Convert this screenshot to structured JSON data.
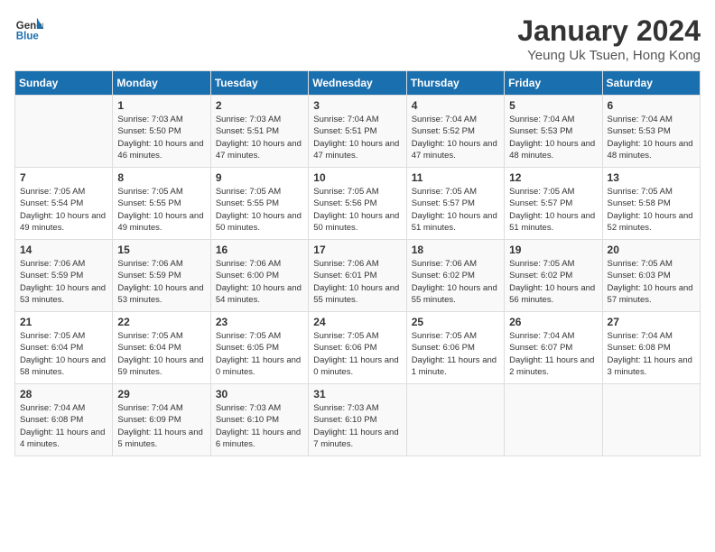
{
  "header": {
    "logo_line1": "General",
    "logo_line2": "Blue",
    "month": "January 2024",
    "location": "Yeung Uk Tsuen, Hong Kong"
  },
  "days_of_week": [
    "Sunday",
    "Monday",
    "Tuesday",
    "Wednesday",
    "Thursday",
    "Friday",
    "Saturday"
  ],
  "weeks": [
    [
      {
        "day": "",
        "sunrise": "",
        "sunset": "",
        "daylight": ""
      },
      {
        "day": "1",
        "sunrise": "Sunrise: 7:03 AM",
        "sunset": "Sunset: 5:50 PM",
        "daylight": "Daylight: 10 hours and 46 minutes."
      },
      {
        "day": "2",
        "sunrise": "Sunrise: 7:03 AM",
        "sunset": "Sunset: 5:51 PM",
        "daylight": "Daylight: 10 hours and 47 minutes."
      },
      {
        "day": "3",
        "sunrise": "Sunrise: 7:04 AM",
        "sunset": "Sunset: 5:51 PM",
        "daylight": "Daylight: 10 hours and 47 minutes."
      },
      {
        "day": "4",
        "sunrise": "Sunrise: 7:04 AM",
        "sunset": "Sunset: 5:52 PM",
        "daylight": "Daylight: 10 hours and 47 minutes."
      },
      {
        "day": "5",
        "sunrise": "Sunrise: 7:04 AM",
        "sunset": "Sunset: 5:53 PM",
        "daylight": "Daylight: 10 hours and 48 minutes."
      },
      {
        "day": "6",
        "sunrise": "Sunrise: 7:04 AM",
        "sunset": "Sunset: 5:53 PM",
        "daylight": "Daylight: 10 hours and 48 minutes."
      }
    ],
    [
      {
        "day": "7",
        "sunrise": "Sunrise: 7:05 AM",
        "sunset": "Sunset: 5:54 PM",
        "daylight": "Daylight: 10 hours and 49 minutes."
      },
      {
        "day": "8",
        "sunrise": "Sunrise: 7:05 AM",
        "sunset": "Sunset: 5:55 PM",
        "daylight": "Daylight: 10 hours and 49 minutes."
      },
      {
        "day": "9",
        "sunrise": "Sunrise: 7:05 AM",
        "sunset": "Sunset: 5:55 PM",
        "daylight": "Daylight: 10 hours and 50 minutes."
      },
      {
        "day": "10",
        "sunrise": "Sunrise: 7:05 AM",
        "sunset": "Sunset: 5:56 PM",
        "daylight": "Daylight: 10 hours and 50 minutes."
      },
      {
        "day": "11",
        "sunrise": "Sunrise: 7:05 AM",
        "sunset": "Sunset: 5:57 PM",
        "daylight": "Daylight: 10 hours and 51 minutes."
      },
      {
        "day": "12",
        "sunrise": "Sunrise: 7:05 AM",
        "sunset": "Sunset: 5:57 PM",
        "daylight": "Daylight: 10 hours and 51 minutes."
      },
      {
        "day": "13",
        "sunrise": "Sunrise: 7:05 AM",
        "sunset": "Sunset: 5:58 PM",
        "daylight": "Daylight: 10 hours and 52 minutes."
      }
    ],
    [
      {
        "day": "14",
        "sunrise": "Sunrise: 7:06 AM",
        "sunset": "Sunset: 5:59 PM",
        "daylight": "Daylight: 10 hours and 53 minutes."
      },
      {
        "day": "15",
        "sunrise": "Sunrise: 7:06 AM",
        "sunset": "Sunset: 5:59 PM",
        "daylight": "Daylight: 10 hours and 53 minutes."
      },
      {
        "day": "16",
        "sunrise": "Sunrise: 7:06 AM",
        "sunset": "Sunset: 6:00 PM",
        "daylight": "Daylight: 10 hours and 54 minutes."
      },
      {
        "day": "17",
        "sunrise": "Sunrise: 7:06 AM",
        "sunset": "Sunset: 6:01 PM",
        "daylight": "Daylight: 10 hours and 55 minutes."
      },
      {
        "day": "18",
        "sunrise": "Sunrise: 7:06 AM",
        "sunset": "Sunset: 6:02 PM",
        "daylight": "Daylight: 10 hours and 55 minutes."
      },
      {
        "day": "19",
        "sunrise": "Sunrise: 7:05 AM",
        "sunset": "Sunset: 6:02 PM",
        "daylight": "Daylight: 10 hours and 56 minutes."
      },
      {
        "day": "20",
        "sunrise": "Sunrise: 7:05 AM",
        "sunset": "Sunset: 6:03 PM",
        "daylight": "Daylight: 10 hours and 57 minutes."
      }
    ],
    [
      {
        "day": "21",
        "sunrise": "Sunrise: 7:05 AM",
        "sunset": "Sunset: 6:04 PM",
        "daylight": "Daylight: 10 hours and 58 minutes."
      },
      {
        "day": "22",
        "sunrise": "Sunrise: 7:05 AM",
        "sunset": "Sunset: 6:04 PM",
        "daylight": "Daylight: 10 hours and 59 minutes."
      },
      {
        "day": "23",
        "sunrise": "Sunrise: 7:05 AM",
        "sunset": "Sunset: 6:05 PM",
        "daylight": "Daylight: 11 hours and 0 minutes."
      },
      {
        "day": "24",
        "sunrise": "Sunrise: 7:05 AM",
        "sunset": "Sunset: 6:06 PM",
        "daylight": "Daylight: 11 hours and 0 minutes."
      },
      {
        "day": "25",
        "sunrise": "Sunrise: 7:05 AM",
        "sunset": "Sunset: 6:06 PM",
        "daylight": "Daylight: 11 hours and 1 minute."
      },
      {
        "day": "26",
        "sunrise": "Sunrise: 7:04 AM",
        "sunset": "Sunset: 6:07 PM",
        "daylight": "Daylight: 11 hours and 2 minutes."
      },
      {
        "day": "27",
        "sunrise": "Sunrise: 7:04 AM",
        "sunset": "Sunset: 6:08 PM",
        "daylight": "Daylight: 11 hours and 3 minutes."
      }
    ],
    [
      {
        "day": "28",
        "sunrise": "Sunrise: 7:04 AM",
        "sunset": "Sunset: 6:08 PM",
        "daylight": "Daylight: 11 hours and 4 minutes."
      },
      {
        "day": "29",
        "sunrise": "Sunrise: 7:04 AM",
        "sunset": "Sunset: 6:09 PM",
        "daylight": "Daylight: 11 hours and 5 minutes."
      },
      {
        "day": "30",
        "sunrise": "Sunrise: 7:03 AM",
        "sunset": "Sunset: 6:10 PM",
        "daylight": "Daylight: 11 hours and 6 minutes."
      },
      {
        "day": "31",
        "sunrise": "Sunrise: 7:03 AM",
        "sunset": "Sunset: 6:10 PM",
        "daylight": "Daylight: 11 hours and 7 minutes."
      },
      {
        "day": "",
        "sunrise": "",
        "sunset": "",
        "daylight": ""
      },
      {
        "day": "",
        "sunrise": "",
        "sunset": "",
        "daylight": ""
      },
      {
        "day": "",
        "sunrise": "",
        "sunset": "",
        "daylight": ""
      }
    ]
  ]
}
